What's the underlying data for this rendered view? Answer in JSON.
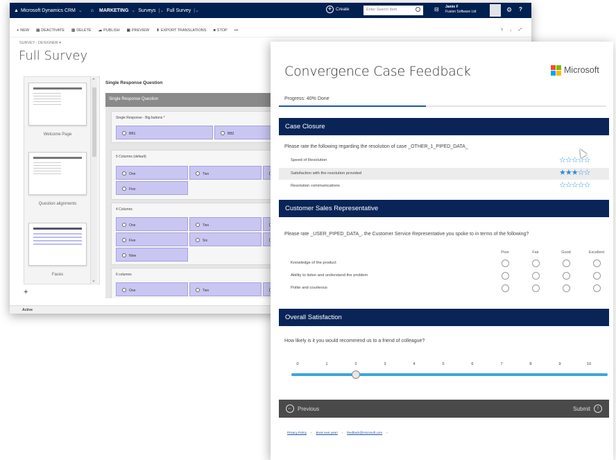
{
  "crm": {
    "nav": {
      "app": "Microsoft Dynamics CRM",
      "area": "MARKETING",
      "entity": "Surveys",
      "record": "Full Survey",
      "create": "Create",
      "search_placeholder": "Enter Search Item",
      "user_name": "Jamie F",
      "user_org": "Fusion Software Ltd"
    },
    "commands": [
      "NEW",
      "DEACTIVATE",
      "DELETE",
      "PUBLISH",
      "PREVIEW",
      "EXPORT TRANSLATIONS",
      "STOP",
      "•••"
    ],
    "breadcrumb": "SURVEY : DESIGNER",
    "title": "Full Survey",
    "pages": [
      "Welcome Page",
      "Question alignments",
      "Faces"
    ],
    "question_heading": "Single Response Question",
    "canvas_bar": "Single Response Question",
    "blocks": [
      {
        "title": "Single Response - Big buttons",
        "options": [
          "BB1",
          "BB2"
        ]
      },
      {
        "title": "5 Columns (default)",
        "options": [
          "One",
          "Two",
          "Five"
        ]
      },
      {
        "title": "4 Columns",
        "options": [
          "One",
          "Two",
          "Five",
          "Six",
          "Nine"
        ]
      },
      {
        "title": "6 columns",
        "options": [
          "One",
          "Two"
        ]
      }
    ],
    "status": "Active"
  },
  "survey": {
    "title": "Convergence Case Feedback",
    "brand": "Microsoft",
    "brand_colors": [
      "#f25022",
      "#7fba00",
      "#00a4ef",
      "#ffb900"
    ],
    "progress_text": "Progress: 40% Done",
    "progress_fraction": 0.4,
    "accent": "#0a2458",
    "sections": {
      "case_closure": {
        "title": "Case Closure",
        "question": "Please rate the following regarding the resolution of case _OTHER_1_PIPED_DATA_",
        "rows": [
          {
            "label": "Speed of Resolution",
            "stars": 0
          },
          {
            "label": "Satisfaction with the resolution provided",
            "stars": 3
          },
          {
            "label": "Resolution communications",
            "stars": 0
          }
        ],
        "max_stars": 5
      },
      "csr": {
        "title": "Customer Sales Representative",
        "question": "Please rate _USER_PIPED_DATA_, the Customer Service Representative you spoke to in terms of the following?",
        "columns": [
          "Poor",
          "Fair",
          "Good",
          "Excellent"
        ],
        "rows": [
          "Knowledge of the product",
          "Ability to listen and understand the problem",
          "Polite and courteous"
        ]
      },
      "overall": {
        "title": "Overall Satisfaction",
        "question": "How likely is it you would recommend us to a friend of colleague?",
        "scale": [
          "0",
          "1",
          "2",
          "3",
          "4",
          "5",
          "6",
          "7",
          "8",
          "9",
          "10"
        ],
        "value": 2
      }
    },
    "previous_label": "Previous",
    "submit_label": "Submit",
    "footer_links": [
      "Privacy Policy",
      "Book next year!",
      "feedback@microsoft.com"
    ]
  }
}
